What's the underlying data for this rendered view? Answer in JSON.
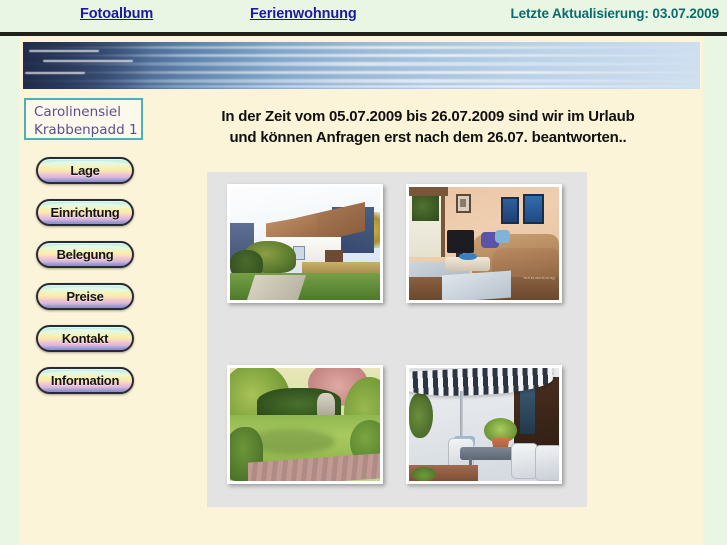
{
  "theme": {
    "page_background": "#e9f6e4",
    "content_background": "#fcf4d9",
    "rule_color": "#20201c",
    "link_color": "#1b1b9e",
    "status_color": "#0e6b6b",
    "card_border_color": "#4cb0b6",
    "card_text_color": "#5a4f8c",
    "gallery_background": "#e3e3e3"
  },
  "topbar": {
    "links": [
      {
        "label": "Fotoalbum",
        "name": "nav-link-fotoalbum"
      },
      {
        "label": "Ferienwohnung",
        "name": "nav-link-ferienwohnung"
      }
    ],
    "last_update": "Letzte Aktualisierung: 03.07.2009"
  },
  "banner": {
    "icon": "sea-banner-image",
    "alt": "Nordsee Wasser Panorama"
  },
  "address_card": {
    "line1": "Carolinensiel",
    "line2": "Krabbenpadd 1"
  },
  "announcement": {
    "line1": "In der Zeit vom 05.07.2009 bis 26.07.2009 sind wir im Urlaub",
    "line2": "und können Anfragen erst nach dem 26.07. beantworten.."
  },
  "sidebar": {
    "items": [
      {
        "label": "Lage",
        "name": "sidebar-item-lage"
      },
      {
        "label": "Einrichtung",
        "name": "sidebar-item-einrichtung"
      },
      {
        "label": "Belegung",
        "name": "sidebar-item-belegung"
      },
      {
        "label": "Preise",
        "name": "sidebar-item-preise"
      },
      {
        "label": "Kontakt",
        "name": "sidebar-item-kontakt"
      },
      {
        "label": "Information",
        "name": "sidebar-item-information"
      }
    ]
  },
  "gallery": {
    "photos": [
      {
        "name": "photo-house",
        "alt": "Haus Außenansicht mit Garten"
      },
      {
        "name": "photo-living",
        "alt": "Wohnzimmer mit Sofa und Fernseher",
        "watermark": "ferienwohnung"
      },
      {
        "name": "photo-garden",
        "alt": "Garten mit Rasen und Terrassenweg"
      },
      {
        "name": "photo-terrace",
        "alt": "Terrasse mit Sonnenschirm und Sitzgruppe"
      }
    ]
  }
}
